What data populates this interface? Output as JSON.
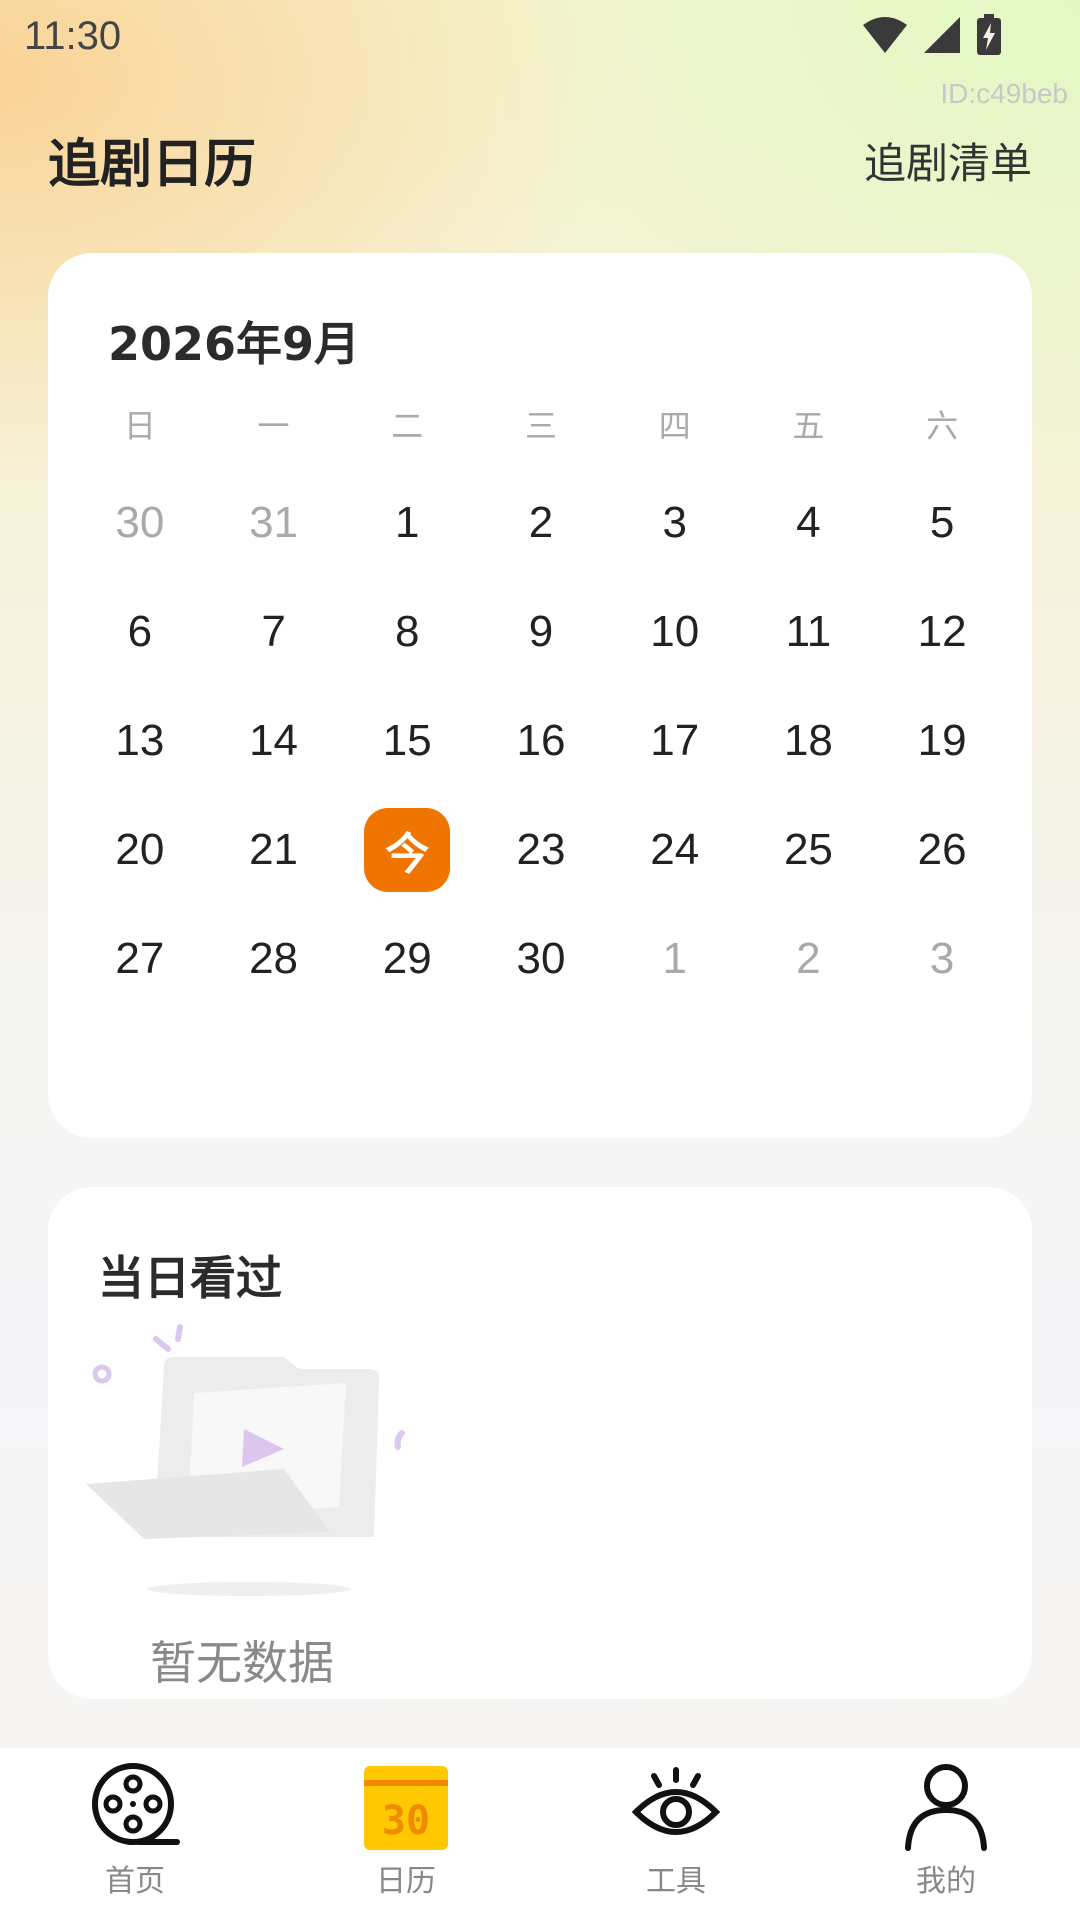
{
  "status_bar": {
    "time": "11:30",
    "user_id": "ID:c49beb"
  },
  "header": {
    "title": "追剧日历",
    "watchlist_label": "追剧清单"
  },
  "calendar": {
    "month_title": "2026年9月",
    "weekdays": [
      "日",
      "一",
      "二",
      "三",
      "四",
      "五",
      "六"
    ],
    "today_label": "今",
    "weeks": [
      [
        {
          "d": "30",
          "m": true
        },
        {
          "d": "31",
          "m": true
        },
        {
          "d": "1"
        },
        {
          "d": "2"
        },
        {
          "d": "3"
        },
        {
          "d": "4"
        },
        {
          "d": "5"
        }
      ],
      [
        {
          "d": "6"
        },
        {
          "d": "7"
        },
        {
          "d": "8"
        },
        {
          "d": "9"
        },
        {
          "d": "10"
        },
        {
          "d": "11"
        },
        {
          "d": "12"
        }
      ],
      [
        {
          "d": "13"
        },
        {
          "d": "14"
        },
        {
          "d": "15"
        },
        {
          "d": "16"
        },
        {
          "d": "17"
        },
        {
          "d": "18"
        },
        {
          "d": "19"
        }
      ],
      [
        {
          "d": "20"
        },
        {
          "d": "21"
        },
        {
          "d": "今",
          "today": true
        },
        {
          "d": "23"
        },
        {
          "d": "24"
        },
        {
          "d": "25"
        },
        {
          "d": "26"
        }
      ],
      [
        {
          "d": "27"
        },
        {
          "d": "28"
        },
        {
          "d": "29"
        },
        {
          "d": "30"
        },
        {
          "d": "1",
          "m": true
        },
        {
          "d": "2",
          "m": true
        },
        {
          "d": "3",
          "m": true
        }
      ]
    ],
    "accent_color": "#f07400"
  },
  "watched": {
    "title": "当日看过",
    "empty_text": "暂无数据"
  },
  "bottom_nav": {
    "items": [
      {
        "label": "首页",
        "icon": "film-reel-icon"
      },
      {
        "label": "日历",
        "icon": "calendar-30-icon",
        "active": true
      },
      {
        "label": "工具",
        "icon": "eye-icon"
      },
      {
        "label": "我的",
        "icon": "user-icon"
      }
    ],
    "active_color": "#ffc800"
  }
}
